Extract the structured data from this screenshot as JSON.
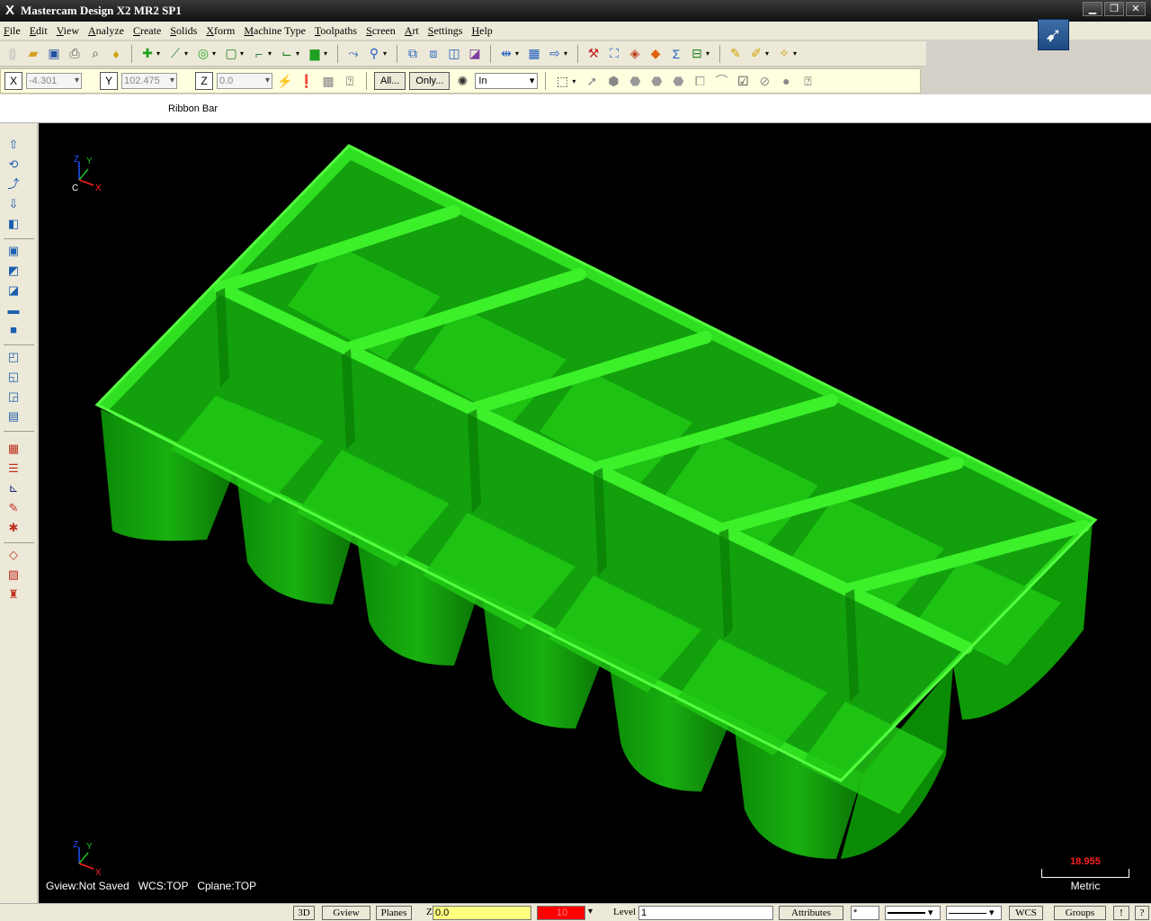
{
  "window": {
    "title": "Mastercam Design X2 MR2 SP1",
    "app_icon": "X"
  },
  "menu": [
    "File",
    "Edit",
    "View",
    "Analyze",
    "Create",
    "Solids",
    "Xform",
    "Machine Type",
    "Toolpaths",
    "Screen",
    "Art",
    "Settings",
    "Help"
  ],
  "coords": {
    "x_label": "X",
    "x_value": "-4.301",
    "y_label": "Y",
    "y_value": "102.475",
    "z_label": "Z",
    "z_value": "0.0"
  },
  "selection": {
    "all_label": "All...",
    "only_label": "Only...",
    "mode": "In"
  },
  "ribbon": {
    "label": "Ribbon Bar"
  },
  "viewport": {
    "gview": "Gview:Not Saved",
    "wcs": "WCS:TOP",
    "cplane": "Cplane:TOP",
    "axis": {
      "z": "Z",
      "y": "Y",
      "x": "X",
      "c": "C"
    },
    "part_color": "#00e000"
  },
  "scale": {
    "value": "18.955",
    "unit": "Metric"
  },
  "status": {
    "btn_3d": "3D",
    "btn_gview": "Gview",
    "btn_planes": "Planes",
    "z_label": "Z",
    "z_value": "0.0",
    "color_value": "10",
    "level_label": "Level",
    "level_value": "1",
    "btn_attributes": "Attributes",
    "point_style": "*",
    "btn_wcs": "WCS",
    "btn_groups": "Groups",
    "btn_bang": "!",
    "btn_help": "?"
  }
}
